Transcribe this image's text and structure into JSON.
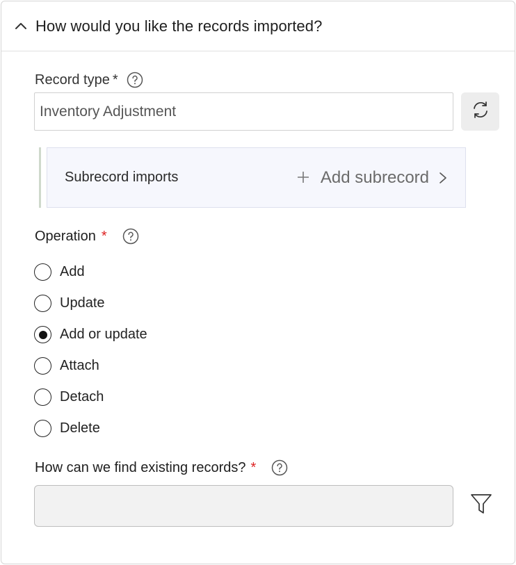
{
  "section": {
    "title": "How would you like the records imported?",
    "collapse_icon": "chevron-up-icon"
  },
  "record_type": {
    "label": "Record type",
    "required_mark": "*",
    "value": "Inventory Adjustment",
    "help_icon": "question-circle-icon",
    "refresh_icon": "refresh-icon"
  },
  "subrecords": {
    "title": "Subrecord imports",
    "add_label": "Add subrecord",
    "plus_icon": "plus-icon",
    "arrow_icon": "chevron-right-icon"
  },
  "operation": {
    "label": "Operation",
    "required_mark": "*",
    "selected": "Add or update",
    "options": [
      "Add",
      "Update",
      "Add or update",
      "Attach",
      "Detach",
      "Delete"
    ]
  },
  "find_existing": {
    "label": "How can we find existing records?",
    "required_mark": "*",
    "value": "",
    "filter_icon": "filter-icon"
  },
  "colors": {
    "required": "#dd2222",
    "subrecord_bg": "#f6f7fd",
    "disabled_input_bg": "#f2f2f2"
  }
}
